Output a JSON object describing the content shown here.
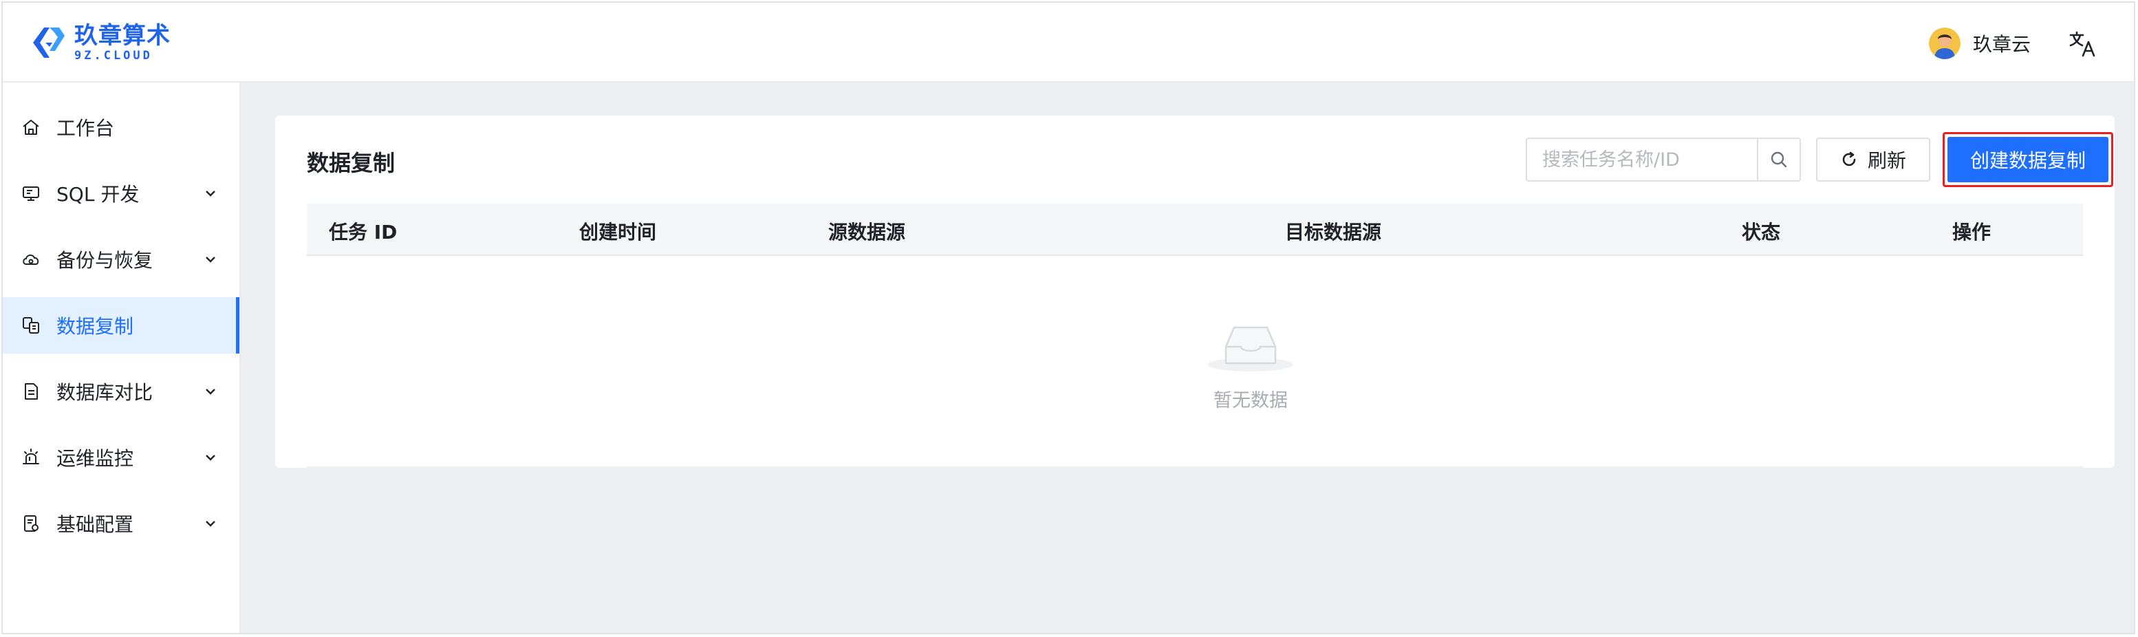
{
  "brand": {
    "name_cn": "玖章算术",
    "name_en": "9Z.CLOUD",
    "accent": "#1e6fff"
  },
  "header": {
    "user_name": "玖章云",
    "avatar_icon": "user-avatar",
    "language_icon": "translate-icon"
  },
  "sidebar": {
    "items": [
      {
        "label": "工作台",
        "icon": "home-icon",
        "expandable": false,
        "active": false
      },
      {
        "label": "SQL 开发",
        "icon": "monitor-icon",
        "expandable": true,
        "active": false
      },
      {
        "label": "备份与恢复",
        "icon": "cloud-icon",
        "expandable": true,
        "active": false
      },
      {
        "label": "数据复制",
        "icon": "copy-data-icon",
        "expandable": false,
        "active": true
      },
      {
        "label": "数据库对比",
        "icon": "compare-doc-icon",
        "expandable": true,
        "active": false
      },
      {
        "label": "运维监控",
        "icon": "alarm-icon",
        "expandable": true,
        "active": false
      },
      {
        "label": "基础配置",
        "icon": "config-icon",
        "expandable": true,
        "active": false
      }
    ]
  },
  "main": {
    "title": "数据复制",
    "search": {
      "placeholder": "搜索任务名称/ID",
      "value": ""
    },
    "refresh_label": "刷新",
    "create_label": "创建数据复制",
    "table": {
      "columns": [
        "任务 ID",
        "创建时间",
        "源数据源",
        "目标数据源",
        "状态",
        "操作"
      ],
      "rows": []
    },
    "empty_text": "暂无数据"
  }
}
